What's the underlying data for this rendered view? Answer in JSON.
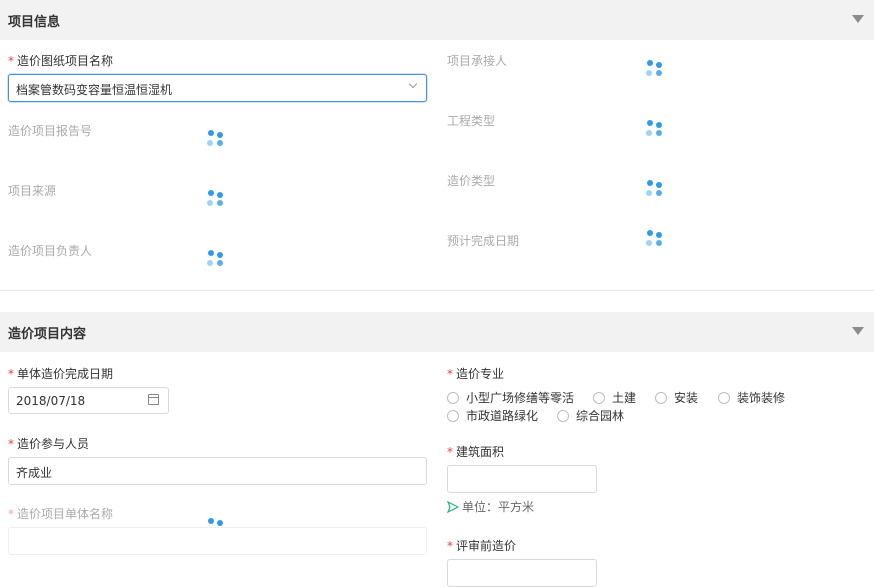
{
  "section1": {
    "title": "项目信息"
  },
  "fields1": {
    "project_name": {
      "required": "*",
      "label": "造价图纸项目名称",
      "value": "档案管数码变容量恒温恒湿机"
    },
    "report_no": {
      "label": "造价项目报告号"
    },
    "source": {
      "label": "项目来源"
    },
    "owner": {
      "label": "造价项目负责人"
    },
    "undertaker": {
      "label": "项目承接人"
    },
    "eng_type": {
      "label": "工程类型"
    },
    "cost_type": {
      "label": "造价类型"
    },
    "expected_date": {
      "label": "预计完成日期"
    }
  },
  "section2": {
    "title": "造价项目内容"
  },
  "fields2": {
    "complete_date": {
      "required": "*",
      "label": "单体造价完成日期",
      "value": "2018/07/18"
    },
    "participants": {
      "required": "*",
      "label": "造价参与人员",
      "value": "齐成业"
    },
    "unit_name": {
      "required": "*",
      "label": "造价项目单体名称"
    },
    "specialty": {
      "required": "*",
      "label": "造价专业",
      "options": [
        "小型广场修缮等零活",
        "土建",
        "安装",
        "装饰装修",
        "市政道路绿化",
        "综合园林"
      ]
    },
    "area": {
      "required": "*",
      "label": "建筑面积",
      "unit_hint": "单位：平方米"
    },
    "pre_review": {
      "required": "*",
      "label": "评审前造价"
    }
  }
}
